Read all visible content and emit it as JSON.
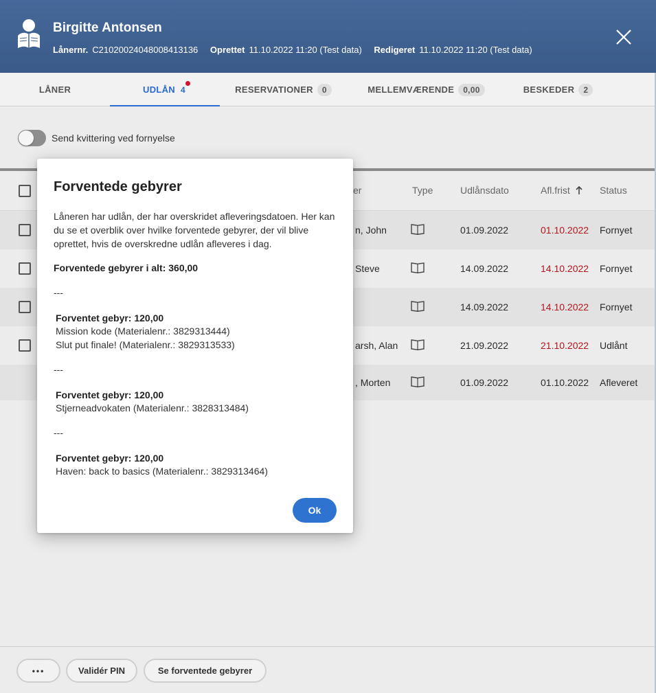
{
  "header": {
    "name": "Birgitte Antonsen",
    "loaner_label": "Lånernr.",
    "loaner_value": "C21020024048008413136",
    "created_label": "Oprettet",
    "created_value": "11.10.2022 11:20 (Test data)",
    "edited_label": "Redigeret",
    "edited_value": "11.10.2022 11:20 (Test data)"
  },
  "tabs": [
    {
      "label": "LÅNER",
      "count": null,
      "active": false
    },
    {
      "label": "UDLÅN",
      "count": "4",
      "active": true
    },
    {
      "label": "RESERVATIONER",
      "count": "0",
      "active": false
    },
    {
      "label": "MELLEMVÆRENDE",
      "count": "0,00",
      "active": false
    },
    {
      "label": "BESKEDER",
      "count": "2",
      "active": false
    }
  ],
  "toggle": {
    "label": "Send kvittering ved fornyelse",
    "on": false
  },
  "table": {
    "columns": {
      "author": "er",
      "type": "Type",
      "loan_date": "Udlånsdato",
      "due": "Afl.frist",
      "status": "Status"
    },
    "rows": [
      {
        "author": "n, John",
        "loan_date": "01.09.2022",
        "due": "01.10.2022",
        "status": "Fornyet",
        "late": true,
        "checkbox": true
      },
      {
        "author": "Steve",
        "loan_date": "14.09.2022",
        "due": "14.10.2022",
        "status": "Fornyet",
        "late": true,
        "checkbox": true
      },
      {
        "author": "",
        "loan_date": "14.09.2022",
        "due": "14.10.2022",
        "status": "Fornyet",
        "late": true,
        "checkbox": true
      },
      {
        "author": "arsh, Alan",
        "loan_date": "21.09.2022",
        "due": "21.10.2022",
        "status": "Udlånt",
        "late": true,
        "checkbox": true
      },
      {
        "author": ", Morten",
        "loan_date": "01.09.2022",
        "due": "01.10.2022",
        "status": "Afleveret",
        "late": false,
        "checkbox": false
      }
    ]
  },
  "dialog": {
    "title": "Forventede gebyrer",
    "intro": "Låneren har udlån, der har overskridet afleveringsdatoen. Her kan du se et overblik over hvilke forventede gebyrer, der vil blive oprettet, hvis de overskredne udlån afleveres i dag.",
    "total": "Forventede gebyrer i alt: 360,00",
    "separator": "---",
    "groups": [
      {
        "title": "Forventet gebyr: 120,00",
        "items": [
          "Mission kode (Materialenr.: 3829313444)",
          "Slut put finale! (Materialenr.: 3829313533)"
        ]
      },
      {
        "title": "Forventet gebyr: 120,00",
        "items": [
          "Stjerneadvokaten (Materialenr.: 3828313484)"
        ]
      },
      {
        "title": "Forventet gebyr: 120,00",
        "items": [
          "Haven: back to basics (Materialenr.: 3829313464)"
        ]
      }
    ],
    "ok_label": "Ok"
  },
  "footer": {
    "more_label": "•••",
    "validate_pin_label": "Validér PIN",
    "expected_fees_label": "Se forventede gebyrer"
  },
  "colors": {
    "header": "#3d5f8c",
    "accent": "#2a6ad0",
    "late": "#b3141e",
    "badge_dot": "#d0132b"
  },
  "icons": {
    "avatar": "reader-icon",
    "close": "close-icon",
    "type": "book-icon",
    "sort": "arrow-up-icon"
  }
}
